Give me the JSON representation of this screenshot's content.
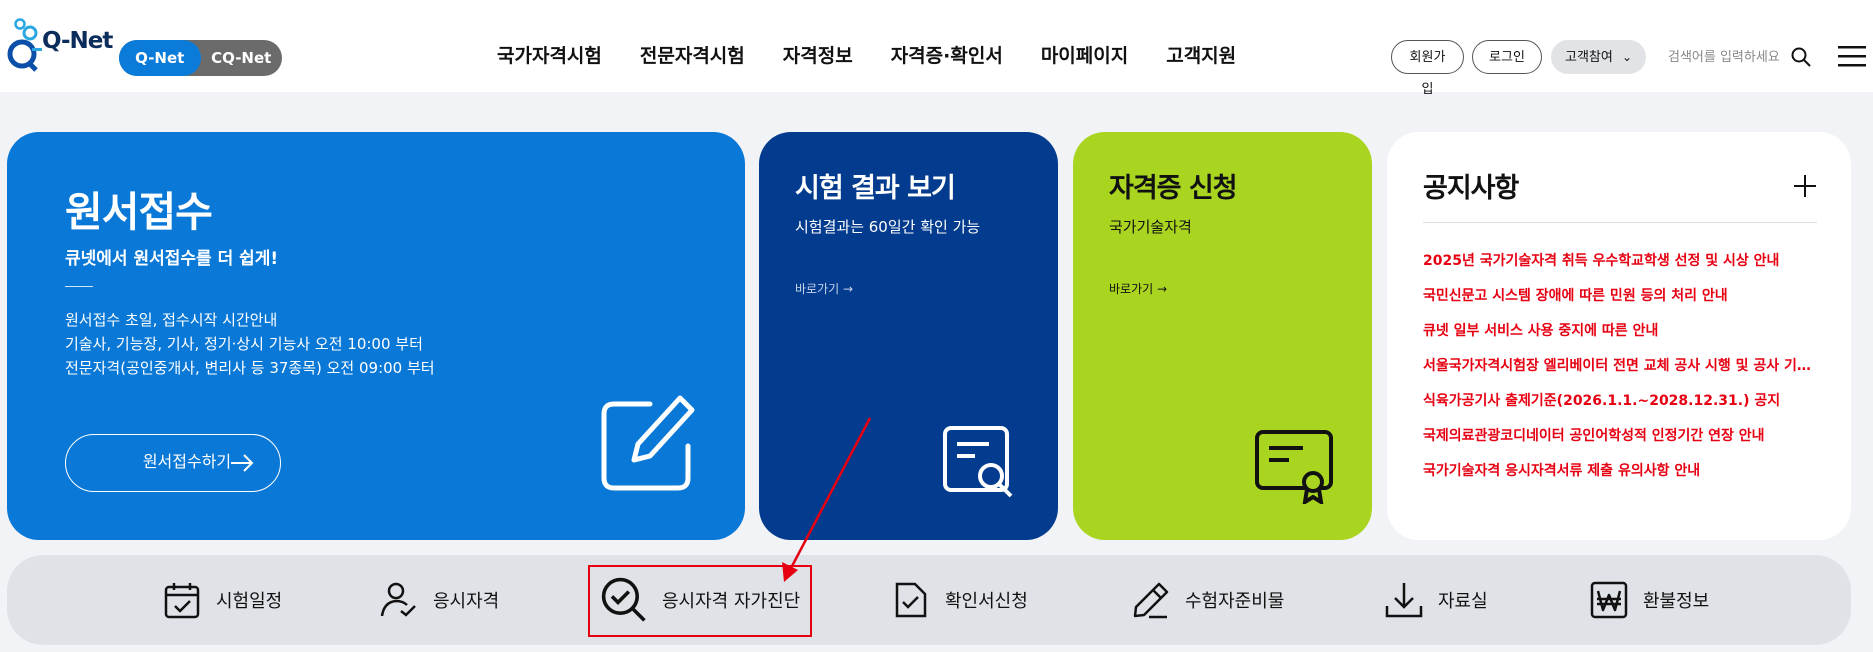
{
  "header": {
    "logo_text": "Q-Net",
    "service_toggle": [
      "Q-Net",
      "CQ-Net"
    ],
    "nav": [
      "국가자격시험",
      "전문자격시험",
      "자격정보",
      "자격증·확인서",
      "마이페이지",
      "고객지원"
    ],
    "join_label": "회원가입",
    "login_label": "로그인",
    "customer_label": "고객참여",
    "search_placeholder": "검색어를 입력하세요"
  },
  "apply_card": {
    "title": "원서접수",
    "subtitle": "큐넷에서 원서접수를 더 쉽게!",
    "info": [
      "원서접수 초일, 접수시작 시간안내",
      "기술사, 기능장, 기사, 정기·상시 기능사 오전 10:00 부터",
      "전문자격(공인중개사, 변리사 등 37종목) 오전 09:00 부터"
    ],
    "button_label": "원서접수하기",
    "color": "#0a78d6"
  },
  "result_card": {
    "title": "시험 결과 보기",
    "subtitle": "시험결과는 60일간 확인 가능",
    "link_label": "바로가기",
    "color": "#033b8e"
  },
  "cert_card": {
    "title": "자격증 신청",
    "subtitle": "국가기술자격",
    "link_label": "바로가기",
    "color": "#a9d520"
  },
  "notice": {
    "title": "공지사항",
    "items": [
      "2025년 국가기술자격 취득 우수학교학생 선정 및 시상 안내",
      "국민신문고 시스템 장애에 따른 민원 등의 처리 안내",
      "큐넷 일부 서비스 사용 중지에 따른 안내",
      "서울국가자격시험장 엘리베이터 전면 교체 공사 시행 및 공사 기간 안내",
      "식육가공기사 출제기준(2026.1.1.~2028.12.31.) 공지",
      "국제의료관광코디네이터 공인어학성적 인정기간 연장 안내",
      "국가기술자격 응시자격서류 제출 유의사항 안내"
    ],
    "color": "#e60012"
  },
  "quick_menu": [
    {
      "label": "시험일정",
      "icon": "calendar-check-icon"
    },
    {
      "label": "응시자격",
      "icon": "user-check-icon"
    },
    {
      "label": "응시자격 자가진단",
      "icon": "search-check-icon"
    },
    {
      "label": "확인서신청",
      "icon": "document-check-icon"
    },
    {
      "label": "수험자준비물",
      "icon": "pencil-icon"
    },
    {
      "label": "자료실",
      "icon": "download-icon"
    },
    {
      "label": "환불정보",
      "icon": "won-icon"
    }
  ]
}
